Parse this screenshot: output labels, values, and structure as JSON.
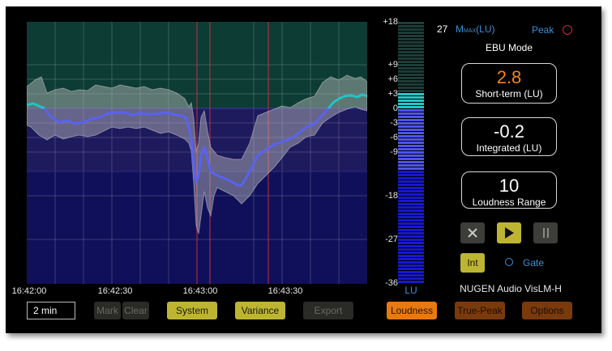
{
  "meter": {
    "max_value": "27",
    "max_label_m": "M",
    "max_label_sub": "MAX",
    "max_label_unit": "(LU)",
    "peak_label": "Peak",
    "mode": "EBU Mode",
    "short_term": {
      "value": "2.8",
      "label": "Short-term (LU)"
    },
    "integrated": {
      "value": "-0.2",
      "label": "Integrated (LU)"
    },
    "loudness_range": {
      "value": "10",
      "label": "Loudness Range"
    },
    "product": "NUGEN Audio VisLM-H",
    "bar_unit": "LU",
    "scale_ticks": [
      "+18",
      "+9",
      "+6",
      "+3",
      "0",
      "-3",
      "-6",
      "-9",
      "-18",
      "-27",
      "-36"
    ],
    "colors": {
      "short_term_value": "#f0861c",
      "accent_blue": "#3b8fd6",
      "history_line": "#20c0c0"
    }
  },
  "timeline": {
    "ticks": [
      "16:42:00",
      "16:42:30",
      "16:43:00",
      "16:43:30"
    ],
    "range_value": "2 min"
  },
  "buttons": {
    "mark": "Mark",
    "clear": "Clear",
    "system": "System",
    "variance": "Variance",
    "export": "Export",
    "int": "Int",
    "gate": "Gate",
    "loudness": "Loudness",
    "true_peak": "True-Peak",
    "options": "Options"
  },
  "transport": {
    "reset_icon": "close-icon",
    "play_icon": "play-icon",
    "pause_icon": "pause-icon"
  }
}
